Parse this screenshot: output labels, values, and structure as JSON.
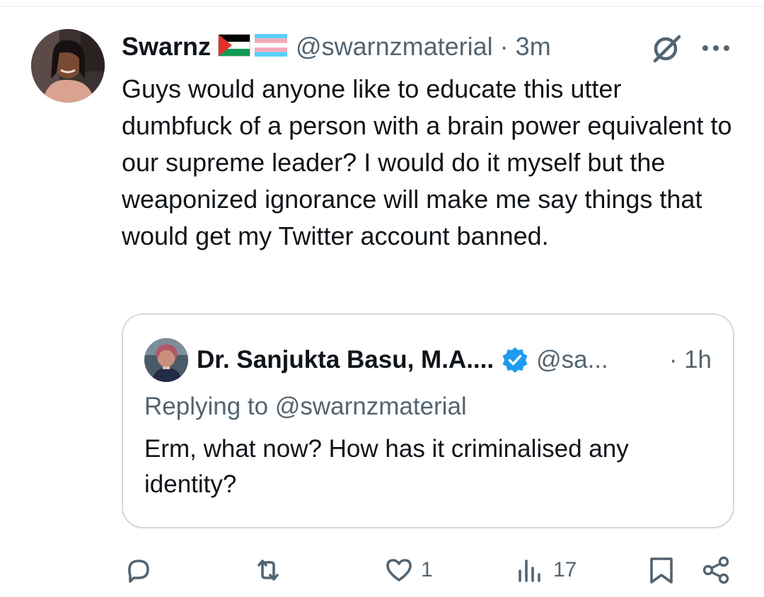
{
  "tweet": {
    "display_name": "Swarnz",
    "handle": "@swarnzmaterial",
    "separator": "·",
    "time": "3m",
    "text": "Guys would anyone like to educate this utter dumbfuck of a person with a brain power equivalent to our supreme leader? I would do it myself but the weaponized ignorance will make me say things that would get my Twitter account banned.",
    "flags": [
      "palestine-flag",
      "transgender-flag"
    ],
    "header_icons": [
      "grok-icon",
      "more-icon"
    ]
  },
  "quote": {
    "display_name": "Dr. Sanjukta Basu, M.A....",
    "verified": true,
    "handle": "@sa...",
    "time": "· 1h",
    "replying_to": "Replying to @swarnzmaterial",
    "text": "Erm, what now? How has it criminalised any identity?"
  },
  "actions": {
    "reply": {
      "icon": "reply-icon",
      "count": ""
    },
    "retweet": {
      "icon": "retweet-icon",
      "count": ""
    },
    "like": {
      "icon": "heart-icon",
      "count": "1"
    },
    "views": {
      "icon": "views-icon",
      "count": "17"
    },
    "bookmark": {
      "icon": "bookmark-icon"
    },
    "share": {
      "icon": "share-icon"
    }
  },
  "colors": {
    "text": "#0f1419",
    "muted": "#536471",
    "border": "#cfd9de",
    "verified": "#1d9bf0"
  }
}
